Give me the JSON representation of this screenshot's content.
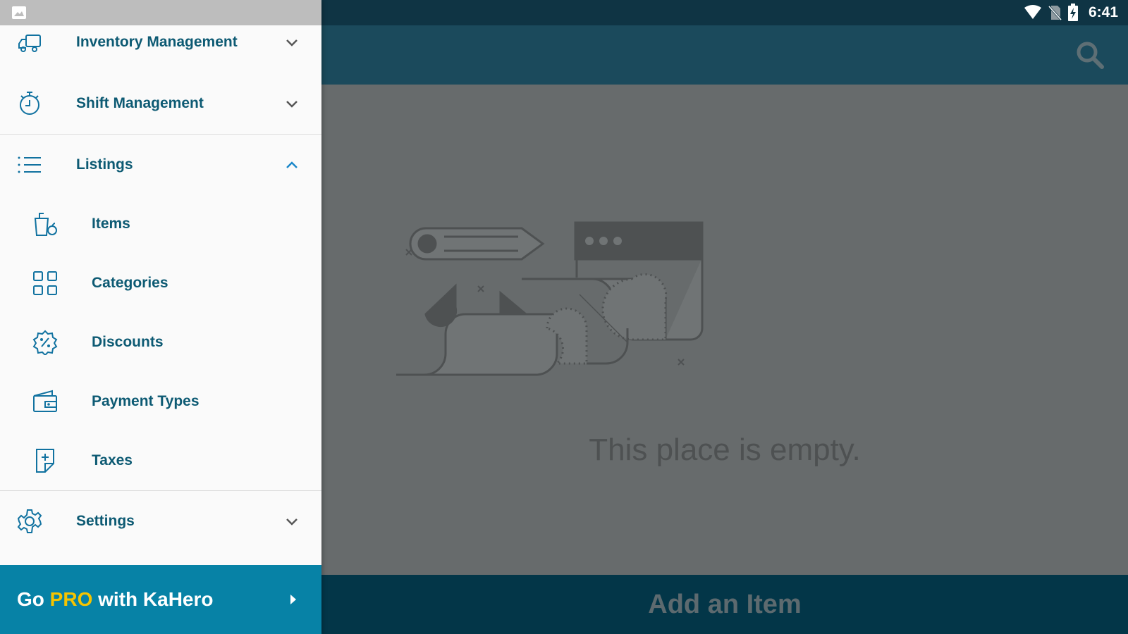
{
  "status_bar": {
    "time": "6:41",
    "icons": [
      "wifi-icon",
      "no-sim-icon",
      "battery-charging-icon"
    ]
  },
  "drawer": {
    "header_icon": "photo-icon",
    "items": [
      {
        "label": "Inventory Management",
        "icon": "truck-icon",
        "expanded": false
      },
      {
        "label": "Shift Management",
        "icon": "stopwatch-icon",
        "expanded": false
      },
      {
        "label": "Listings",
        "icon": "list-icon",
        "expanded": true
      },
      {
        "label": "Settings",
        "icon": "gear-icon",
        "expanded": false
      }
    ],
    "listings_subitems": [
      {
        "label": "Items",
        "icon": "cup-apple-icon"
      },
      {
        "label": "Categories",
        "icon": "grid-icon"
      },
      {
        "label": "Discounts",
        "icon": "discount-badge-icon"
      },
      {
        "label": "Payment Types",
        "icon": "wallet-icon"
      },
      {
        "label": "Taxes",
        "icon": "tax-document-icon"
      }
    ],
    "promo": {
      "prefix": "Go ",
      "highlight": "PRO",
      "suffix": " with KaHero"
    }
  },
  "main": {
    "empty_message": "This place is empty.",
    "add_button_label": "Add an Item",
    "search_icon": "search-icon"
  },
  "colors": {
    "drawer_text": "#0d5a73",
    "promo_bg": "#0782a6",
    "pro_highlight": "#f5c400",
    "status_bar": "#0f3444",
    "app_bar": "#1b4a5c",
    "bottom_bar": "#033648",
    "dim_content": "#676b6c"
  }
}
